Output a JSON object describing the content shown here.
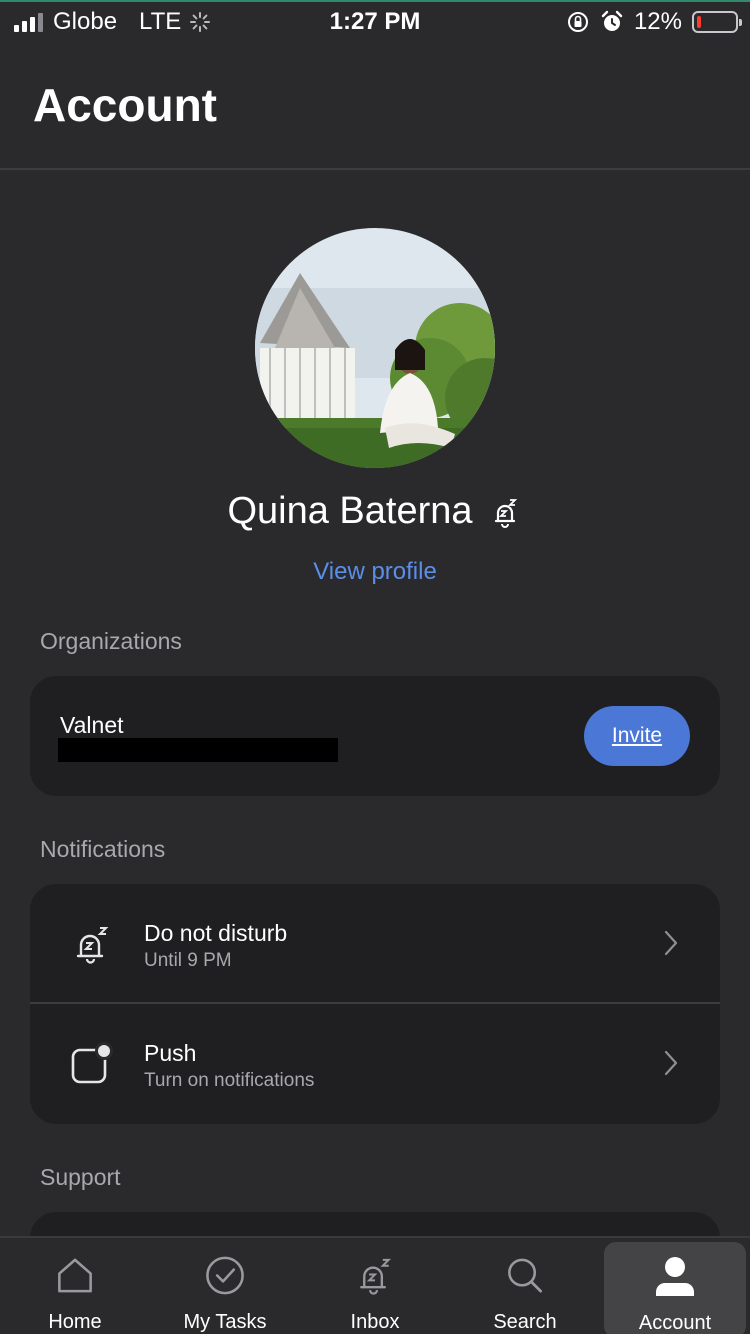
{
  "status_bar": {
    "carrier": "Globe",
    "network": "LTE",
    "time": "1:27 PM",
    "battery": "12%",
    "battery_level": 0.12
  },
  "header": {
    "title": "Account"
  },
  "profile": {
    "name": "Quina Baterna",
    "status_icon": "do-not-disturb-bell-icon",
    "view_profile_label": "View profile"
  },
  "organizations": {
    "section_label": "Organizations",
    "items": [
      {
        "name": "Valnet",
        "invite_label": "Invite"
      }
    ]
  },
  "notifications": {
    "section_label": "Notifications",
    "items": [
      {
        "title": "Do not disturb",
        "subtitle": "Until 9 PM",
        "icon": "do-not-disturb-bell-icon"
      },
      {
        "title": "Push",
        "subtitle": "Turn on notifications",
        "icon": "push-badge-icon"
      }
    ]
  },
  "support": {
    "section_label": "Support"
  },
  "tab_bar": {
    "tabs": [
      {
        "label": "Home",
        "icon": "home-icon"
      },
      {
        "label": "My Tasks",
        "icon": "check-circle-icon"
      },
      {
        "label": "Inbox",
        "icon": "bell-icon"
      },
      {
        "label": "Search",
        "icon": "search-icon"
      },
      {
        "label": "Account",
        "icon": "person-icon",
        "active": true
      }
    ]
  },
  "colors": {
    "background": "#2a2a2c",
    "card": "#1f1f21",
    "accent_link": "#5b8ee8",
    "invite_button": "#4b77d6",
    "secondary_text": "#a8a8ad"
  }
}
